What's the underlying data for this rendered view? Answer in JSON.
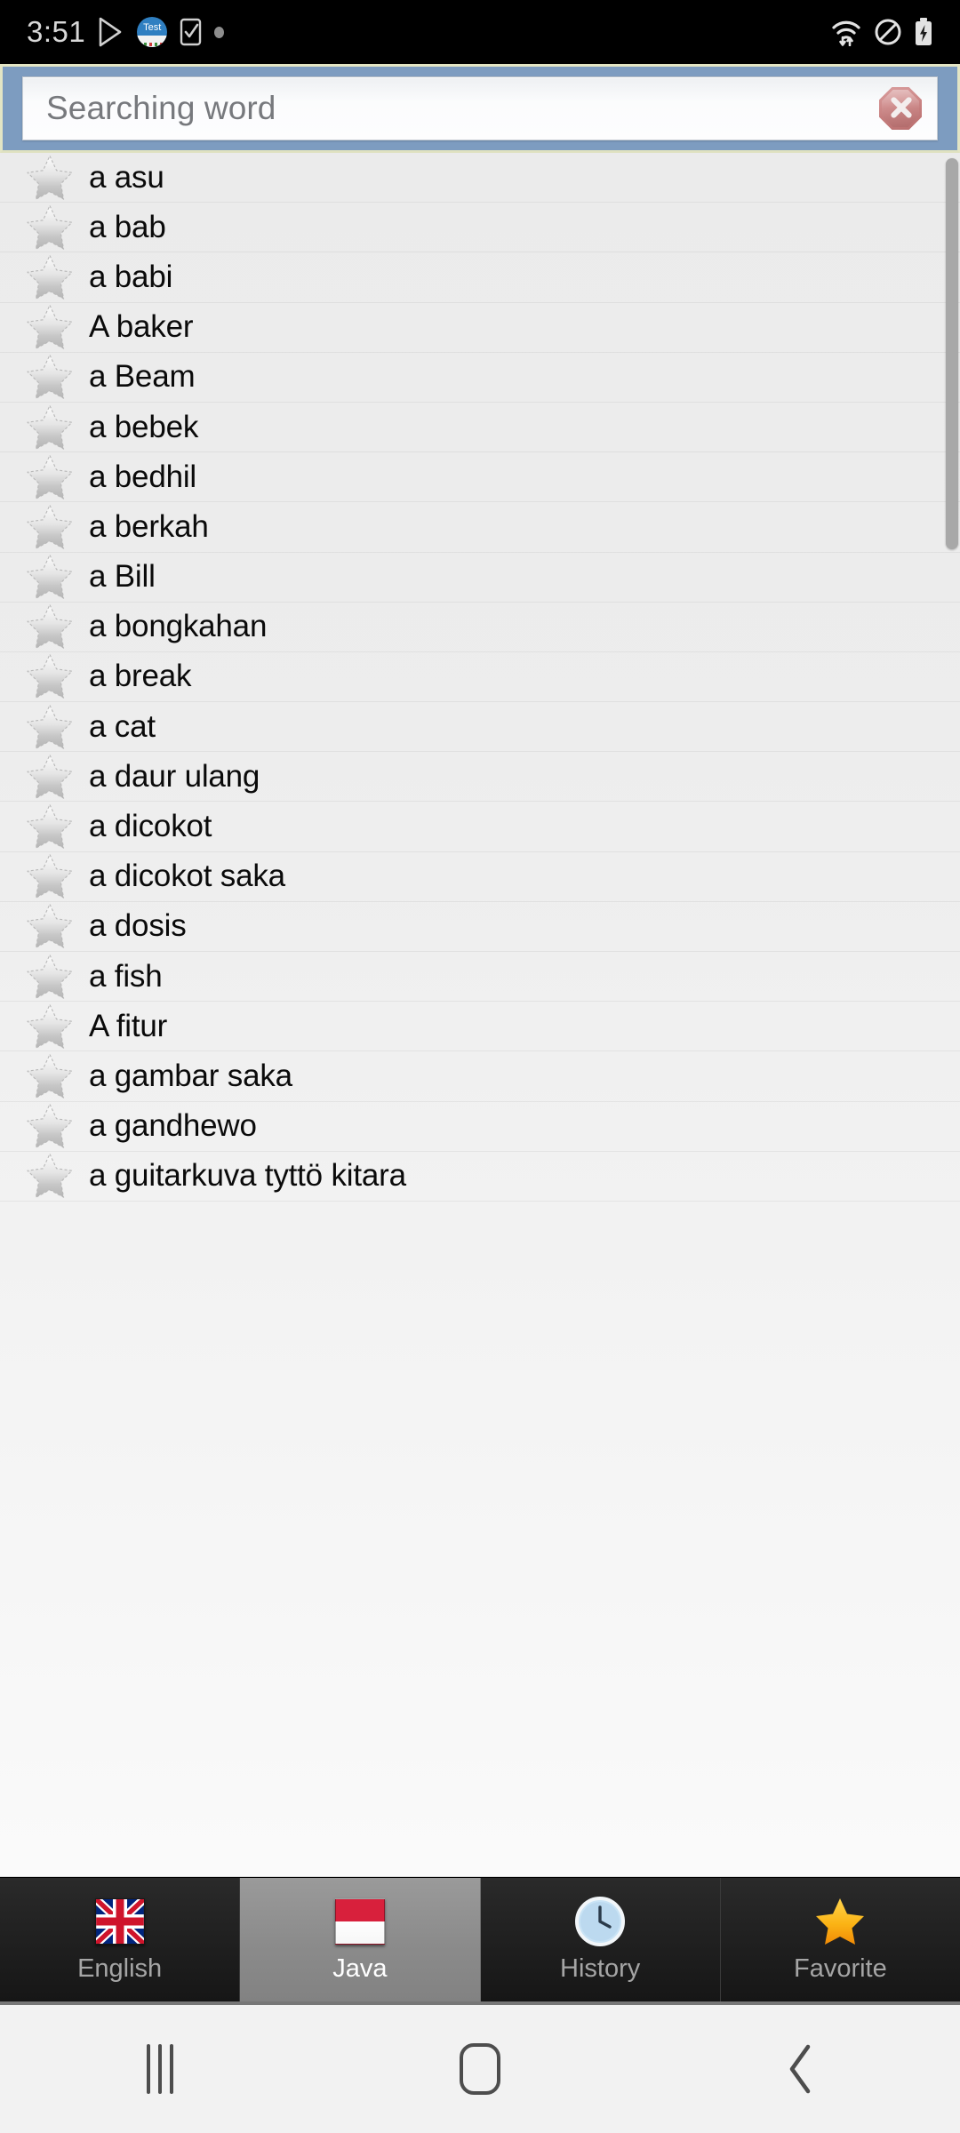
{
  "status_bar": {
    "time": "3:51",
    "left_icons": [
      {
        "name": "play-store-icon",
        "glyph": "play-store"
      },
      {
        "name": "test-app-icon",
        "label": "Test"
      },
      {
        "name": "task-check-icon",
        "glyph": "checkbox"
      },
      {
        "name": "notification-dot-icon",
        "glyph": "dot"
      }
    ],
    "right_icons": [
      {
        "name": "wifi-icon",
        "glyph": "wifi"
      },
      {
        "name": "do-not-disturb-icon",
        "glyph": "circle-slash"
      },
      {
        "name": "battery-charging-icon",
        "glyph": "battery-bolt"
      }
    ]
  },
  "search": {
    "placeholder": "Searching word",
    "value": "",
    "clear_label": "",
    "panel_color": "#7d9cc0",
    "border_color": "#e3e5c4"
  },
  "list": {
    "items": [
      "a asu",
      "a bab",
      "a babi",
      "A baker",
      "a Beam",
      "a bebek",
      "a bedhil",
      "a berkah",
      "a Bill",
      "a bongkahan",
      "a break",
      "a cat",
      "a daur ulang",
      "a dicokot",
      "a dicokot saka",
      "a dosis",
      "a fish",
      "A fitur",
      "a gambar saka",
      "a gandhewo",
      "a guitarkuva tyttö kitara"
    ],
    "star_state": "unfavorited"
  },
  "tabs": [
    {
      "label": "English",
      "icon": "uk-flag-icon",
      "selected": false
    },
    {
      "label": "Java",
      "icon": "indonesia-flag-icon",
      "selected": true
    },
    {
      "label": "History",
      "icon": "clock-icon",
      "selected": false
    },
    {
      "label": "Favorite",
      "icon": "star-icon",
      "selected": false
    }
  ],
  "nav_bar": {
    "recents_label": "Recents",
    "home_label": "Home",
    "back_label": "Back"
  },
  "colors": {
    "accent_blue": "#7d9cc0",
    "selected_tab": "#8c8c8c",
    "favorite_star": "#f9a01b",
    "clear_button": "#c57d7d"
  }
}
